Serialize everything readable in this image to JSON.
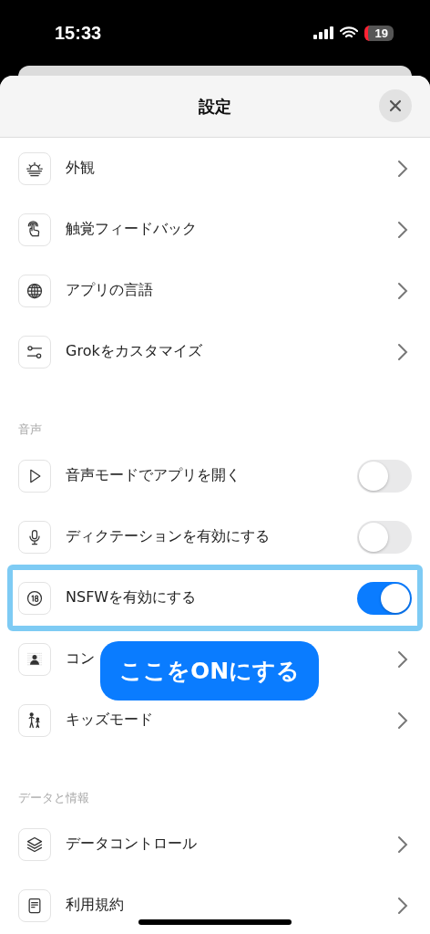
{
  "status_bar": {
    "time": "15:33",
    "battery": "19"
  },
  "sheet": {
    "title": "設定"
  },
  "sections": [
    {
      "items": [
        {
          "label": "外観",
          "kind": "link",
          "highlighted": false
        },
        {
          "label": "触覚フィードバック",
          "kind": "link",
          "highlighted": false
        },
        {
          "label": "アプリの言語",
          "kind": "link",
          "highlighted": false
        },
        {
          "label": "Grokをカスタマイズ",
          "kind": "link",
          "highlighted": false
        }
      ]
    },
    {
      "header": "音声",
      "items": [
        {
          "label": "音声モードでアプリを開く",
          "kind": "toggle",
          "on": false,
          "highlighted": false
        },
        {
          "label": "ディクテーションを有効にする",
          "kind": "toggle",
          "on": false,
          "highlighted": false
        },
        {
          "label": "NSFWを有効にする",
          "kind": "toggle",
          "on": true,
          "highlighted": true
        },
        {
          "label": "コン",
          "kind": "link",
          "highlighted": false
        },
        {
          "label": "キッズモード",
          "kind": "link",
          "highlighted": false
        }
      ]
    },
    {
      "header": "データと情報",
      "items": [
        {
          "label": "データコントロール",
          "kind": "link",
          "highlighted": false
        },
        {
          "label": "利用規約",
          "kind": "link",
          "highlighted": false
        }
      ]
    }
  ],
  "callout": {
    "text": "ここをONにする"
  }
}
